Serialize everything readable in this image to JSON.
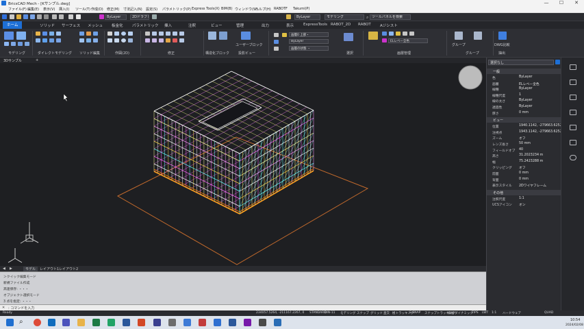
{
  "window": {
    "title": "BricsCAD Mech - [Kサンプル.dwg]",
    "minimize": "—",
    "maximize": "☐",
    "close": "✕"
  },
  "menu": [
    "ファイル(F)",
    "編集(E)",
    "表示(V)",
    "挿入(I)",
    "ツール(T)",
    "作成(D)",
    "修正(M)",
    "寸法記入(N)",
    "設定(S)",
    "パラメトリック(P)",
    "Express Tools(X)",
    "BIM(B)",
    "ウィンドウ(W)",
    "ヘルプ(H)",
    "RABOTF",
    "Takumi(P)"
  ],
  "qat": {
    "layer_value": "ByLayer",
    "color_label": "ByLayer",
    "workspace": "2Dドラフト",
    "mode": "モデリング",
    "search_placeholder": "ツールパネルを検索"
  },
  "ribbon_tabs": [
    "ホーム",
    "ソリッド",
    "サーフェス",
    "メッシュ",
    "板金化",
    "パラメトリック",
    "挿入",
    "注釈",
    "ビュー",
    "管理",
    "出力",
    "表示",
    "ExpressTools",
    "RABOT_2D",
    "RABOT",
    "Aジシスト"
  ],
  "ribbon_groups": [
    "モデリング",
    "ダイレクトモデリング",
    "ソリッド編集",
    "作図(2D)",
    "修正",
    "構造化ブロック",
    "投影ビュー",
    "選択",
    "画層管理",
    "グループ",
    "抽出"
  ],
  "ribbon_buttons": {
    "layer_combo": "画層0 上部・",
    "layer_combo2": "ByLayer",
    "layer_state": "画層の状態 ・",
    "user_block": "ユーザーブロック",
    "layer_group_btn": "グループ",
    "dwg_btn": "DWG比較"
  },
  "doc_tabs": [
    "3Dサンプル",
    "+"
  ],
  "layout_tabs": [
    "◀",
    "▶",
    "モデル",
    "レイアウト1",
    "レイアウト2"
  ],
  "command_history": [
    "＞クイック編集モード",
    "新規ファイル作成",
    "高速保存: ・・・",
    "オブジェクト選択モード",
    "3 点を指定: ・・・"
  ],
  "command_prompt": ": コマンドを入力",
  "status": {
    "ready": "Ready",
    "coords": "234057.5264, -211167.2267, 0",
    "items": [
      "STANDARD",
      "DIN-11",
      "モデリング",
      "スナップ",
      "グリッド",
      "直交",
      "極トラッキング",
      "E.SNAP",
      "スナップトラッキング",
      "線幅",
      "ダイナミック",
      "TIPS",
      "LWT",
      "1:1",
      "ハードウェア",
      "QUAD"
    ]
  },
  "properties": {
    "filter": "選択なし",
    "sections": [
      {
        "name": "一般",
        "rows": [
          {
            "k": "色",
            "v": "ByLayer"
          },
          {
            "k": "画層",
            "v": "ELレベー全色"
          },
          {
            "k": "線種",
            "v": "ByLayer"
          },
          {
            "k": "線種尺度",
            "v": "1"
          },
          {
            "k": "線の太さ",
            "v": "ByLayer"
          },
          {
            "k": "透過性",
            "v": "ByLayer"
          },
          {
            "k": "厚さ",
            "v": "0 mm"
          }
        ]
      },
      {
        "name": "ビュー",
        "rows": [
          {
            "k": "位置",
            "v": "1940.1142, -279663.6252, 5"
          },
          {
            "k": "注視点",
            "v": "1943.1142, -279663.6252, 5"
          },
          {
            "k": "ズーム",
            "v": "オフ"
          },
          {
            "k": "レンズ長さ",
            "v": "50 mm"
          },
          {
            "k": "フィールドオブ",
            "v": "40"
          },
          {
            "k": "高さ",
            "v": "31.2023234 m"
          },
          {
            "k": "幅",
            "v": "75.2423288 m"
          },
          {
            "k": "クリッピング",
            "v": "オフ"
          },
          {
            "k": "前面",
            "v": "0 mm"
          },
          {
            "k": "背面",
            "v": "0 mm"
          },
          {
            "k": "表示スタイル",
            "v": "2Dワイヤフレーム"
          }
        ]
      },
      {
        "name": "その他",
        "rows": [
          {
            "k": "注釈尺度",
            "v": "1:1"
          },
          {
            "k": "UCSアイコン",
            "v": "オン"
          }
        ]
      }
    ]
  },
  "clock": {
    "time": "10:54",
    "date": "2024/02/08"
  },
  "colors": {
    "accent": "#1d6fd6",
    "model_wire": "#f2f2a0",
    "layer_magenta": "#cc33cc"
  }
}
